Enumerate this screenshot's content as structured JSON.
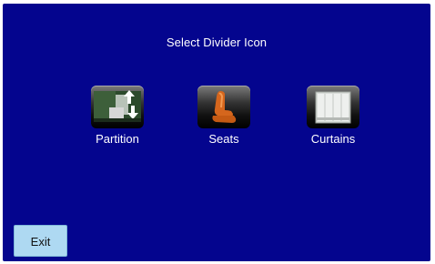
{
  "screen": {
    "title": "Select Divider Icon"
  },
  "options": [
    {
      "label": "Partition",
      "icon": "partition-icon"
    },
    {
      "label": "Seats",
      "icon": "seat-icon"
    },
    {
      "label": "Curtains",
      "icon": "curtains-icon"
    }
  ],
  "footer": {
    "exit_label": "Exit"
  },
  "colors": {
    "background": "#04058e",
    "text": "#ffffff",
    "exit_button": "#aed9f2"
  }
}
